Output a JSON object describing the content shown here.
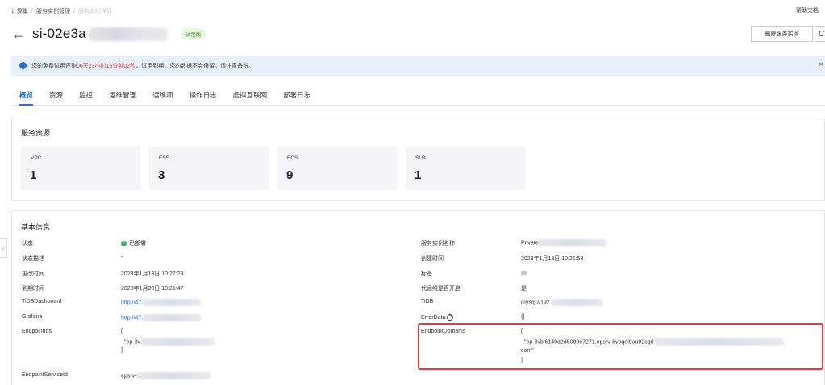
{
  "breadcrumb": {
    "items": [
      "计算巢",
      "服务实例管理",
      "服务实例详情"
    ]
  },
  "header": {
    "help": "帮助文档",
    "title": "si-02e3a",
    "badge": "试用版",
    "delete_label": "删除服务实例",
    "refresh_glyph": "C"
  },
  "alert": {
    "prefix": "您的免费试用还剩",
    "countdown": "06天23小时15分钟02秒",
    "suffix": "，试用到期，您的数据不会保留，请注意备份。",
    "close": "×"
  },
  "tabs": [
    "概览",
    "资源",
    "监控",
    "运维管理",
    "运维项",
    "操作日志",
    "虚拟互联网",
    "部署日志"
  ],
  "resources": {
    "title": "服务资源",
    "stats": [
      {
        "label": "VPC",
        "value": "1"
      },
      {
        "label": "ESS",
        "value": "3"
      },
      {
        "label": "ECS",
        "value": "9"
      },
      {
        "label": "SLB",
        "value": "1"
      }
    ]
  },
  "info": {
    "title": "基本信息",
    "left": {
      "status_label": "状态",
      "status_value": "已部署",
      "desc_label": "状态描述",
      "desc_value": "-",
      "update_label": "更改时间",
      "update_value": "2023年1月13日 10:27:28",
      "expire_label": "到期时间",
      "expire_value": "2023年1月20日 10:21:47",
      "tidb_dash_label": "TiDBDashboard",
      "tidb_dash_value": "http://47.",
      "grafana_label": "Grafana",
      "grafana_value": "http://47.",
      "endpoint_ids_label": "EndpointIds",
      "endpoint_ids_open": "[",
      "endpoint_ids_item": "\"ep-8v",
      "endpoint_ids_close": "]",
      "endpoint_service_label": "EndpointServiceId",
      "endpoint_service_value": "epsrv-"
    },
    "right": {
      "name_label": "服务实例名称",
      "name_value": "Private",
      "created_label": "创建时间",
      "created_value": "2023年1月13日 10:21:53",
      "tags_label": "标签",
      "ops_label": "代运维是否开启",
      "ops_value": "是",
      "tidb_label": "TiDB",
      "tidb_value": "mysql://192.",
      "error_label": "ErrorData",
      "error_value": "{}",
      "domains_label": "EndpointDomains",
      "domains_open": "[",
      "domains_line1": "\"ep-8vbi6149d2d5099e7271.epsrv-8vbqei9au92cqrl",
      "domains_line1_end": ".",
      "domains_line2": "com\"",
      "domains_close": "]"
    }
  },
  "colors": {
    "accent": "#1f6ee8",
    "danger": "#e4393c",
    "success": "#3cb35a",
    "highlight": "#e23b3b"
  }
}
